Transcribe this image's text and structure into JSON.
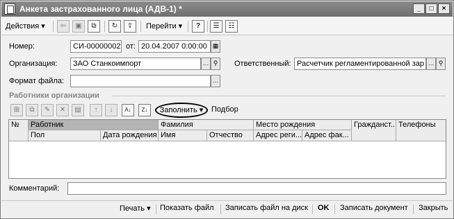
{
  "window": {
    "title": "Анкета застрахованного лица (АДВ-1) *",
    "controls": {
      "minimize": "_",
      "maximize": "□",
      "close": "×"
    }
  },
  "toolbar": {
    "actions_label": "Действия",
    "goto_label": "Перейти",
    "help_label": "?"
  },
  "form": {
    "number_label": "Номер:",
    "number_value": "СИ-00000002",
    "date_label": "от:",
    "date_value": "20.04.2007  0:00:00",
    "org_label": "Организация:",
    "org_value": "ЗАО Станкоимпорт",
    "responsible_label": "Ответственный:",
    "responsible_value": "Расчетчик регламентированной зар",
    "file_format_label": "Формат файла:",
    "file_format_value": ""
  },
  "employees": {
    "section_title": "Работники организации",
    "fill_label": "Заполнить",
    "selection_label": "Подбор",
    "columns_row1": [
      "№",
      "Работник",
      "Фамилия",
      "Место рождения",
      "Гражданст...",
      "Телефоны"
    ],
    "columns_row2": [
      "Пол",
      "Дата рождения",
      "Имя",
      "Отчество",
      "Адрес реги...",
      "Адрес фак..."
    ]
  },
  "comment": {
    "label": "Комментарий:",
    "value": ""
  },
  "bottom": {
    "print_label": "Печать",
    "show_file_label": "Показать файл",
    "write_file_label": "Записать файл на диск",
    "ok_label": "OK",
    "save_doc_label": "Записать документ",
    "close_label": "Закрыть"
  }
}
